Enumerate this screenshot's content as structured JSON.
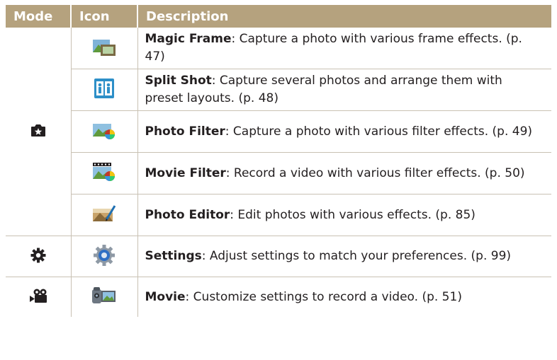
{
  "header": {
    "mode": "Mode",
    "icon": "Icon",
    "description": "Description"
  },
  "colors": {
    "header_bg": "#b5a27e",
    "rule": "#c9c1b3"
  },
  "rows": [
    {
      "mode_icon": "camera-star-icon",
      "icon": "magic-frame-icon",
      "title": "Magic Frame",
      "text": ": Capture a photo with various frame effects. (p. 47)"
    },
    {
      "icon": "split-shot-icon",
      "title": "Split Shot",
      "text": ": Capture several photos and arrange them with preset layouts. (p. 48)"
    },
    {
      "icon": "photo-filter-icon",
      "title": "Photo Filter",
      "text": ": Capture a photo with various filter effects. (p. 49)"
    },
    {
      "icon": "movie-filter-icon",
      "title": "Movie Filter",
      "text": ": Record a video with various filter effects. (p. 50)"
    },
    {
      "icon": "photo-editor-icon",
      "title": "Photo Editor",
      "text": ": Edit photos with various effects. (p. 85)"
    },
    {
      "mode_icon": "gear-icon",
      "icon": "settings-icon",
      "title": "Settings",
      "text": ": Adjust settings to match your preferences. (p. 99)"
    },
    {
      "mode_icon": "movie-camera-icon",
      "icon": "movie-icon",
      "title": "Movie",
      "text": ": Customize settings to record a video. (p. 51)"
    }
  ]
}
